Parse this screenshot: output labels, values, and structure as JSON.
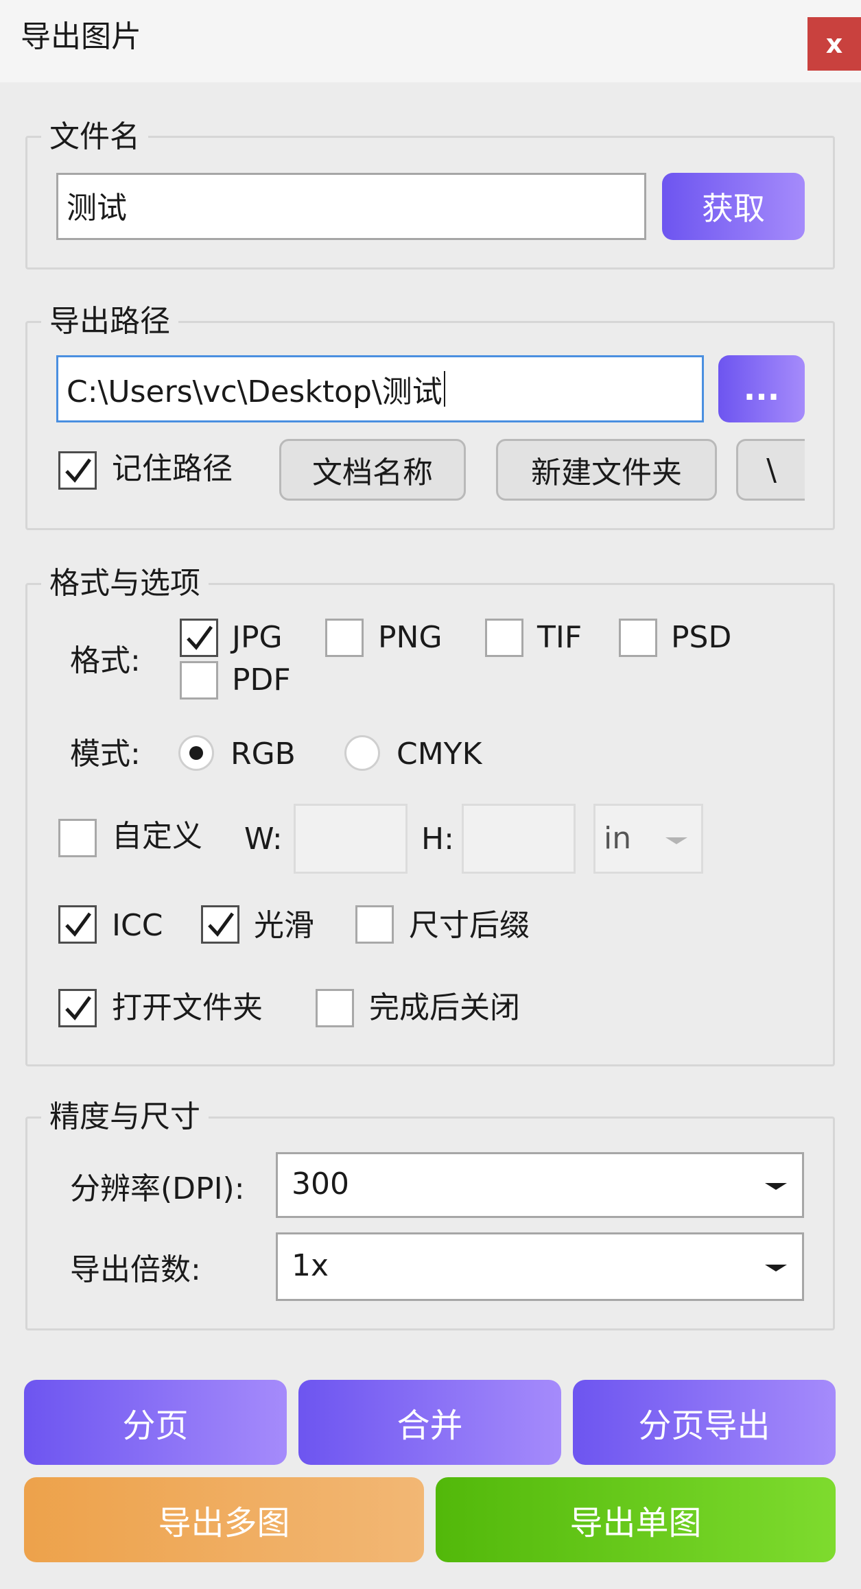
{
  "window": {
    "title": "导出图片",
    "close_label": "x"
  },
  "filename": {
    "legend": "文件名",
    "value": "测试",
    "fetch_button": "获取"
  },
  "path": {
    "legend": "导出路径",
    "value": "C:\\Users\\vc\\Desktop\\测试",
    "browse_button": "...",
    "remember": {
      "label": "记住路径",
      "checked": true
    },
    "doc_name_button": "文档名称",
    "new_folder_button": "新建文件夹",
    "separator_button": "\\"
  },
  "format": {
    "legend": "格式与选项",
    "format_label": "格式:",
    "formats": [
      {
        "label": "JPG",
        "checked": true
      },
      {
        "label": "PNG",
        "checked": false
      },
      {
        "label": "TIF",
        "checked": false
      },
      {
        "label": "PSD",
        "checked": false
      },
      {
        "label": "PDF",
        "checked": false
      }
    ],
    "mode_label": "模式:",
    "modes": [
      {
        "label": "RGB",
        "selected": true
      },
      {
        "label": "CMYK",
        "selected": false
      }
    ],
    "custom": {
      "label": "自定义",
      "checked": false,
      "w_label": "W:",
      "h_label": "H:",
      "w_value": "",
      "h_value": "",
      "unit": "in"
    },
    "icc": {
      "label": "ICC",
      "checked": true
    },
    "smooth": {
      "label": "光滑",
      "checked": true
    },
    "size_suffix": {
      "label": "尺寸后缀",
      "checked": false
    },
    "open_folder": {
      "label": "打开文件夹",
      "checked": true
    },
    "close_after": {
      "label": "完成后关闭",
      "checked": false
    }
  },
  "precision": {
    "legend": "精度与尺寸",
    "dpi_label": "分辨率(DPI):",
    "dpi_value": "300",
    "scale_label": "导出倍数:",
    "scale_value": "1x"
  },
  "actions": {
    "paging": "分页",
    "merge": "合并",
    "paging_export": "分页导出",
    "export_multi": "导出多图",
    "export_single": "导出单图"
  },
  "colors": {
    "purple_start": "#6d55f0",
    "purple_end": "#a58bfb",
    "orange_start": "#eda24b",
    "orange_end": "#f2b774",
    "green_start": "#52b80a",
    "green_end": "#7edb2e",
    "close": "#c9413e",
    "focus": "#4a8fe0"
  }
}
